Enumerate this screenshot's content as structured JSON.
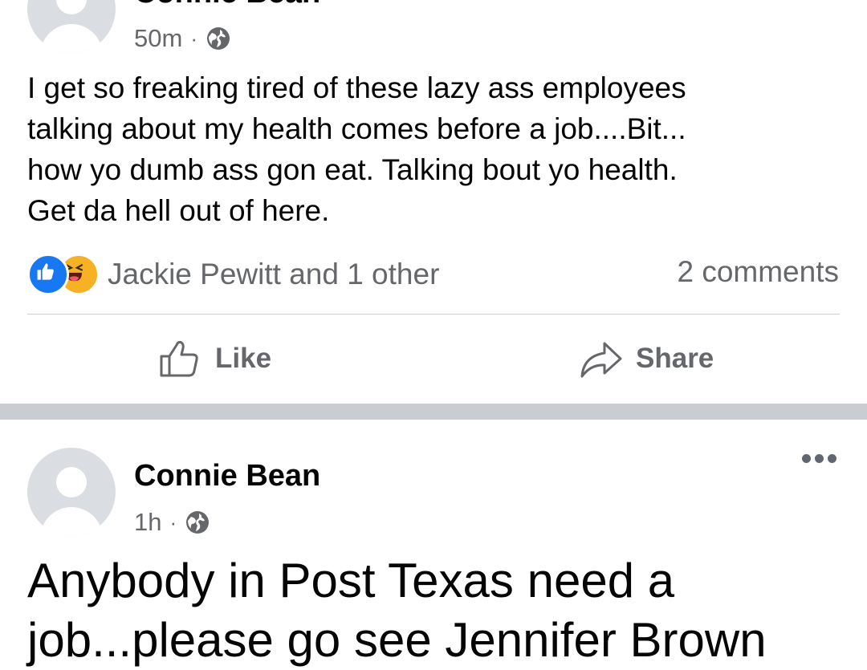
{
  "post1": {
    "author": "Connie Bean",
    "time": "50m",
    "visibility_icon": "globe-icon",
    "text_lines": [
      "I get so freaking tired of these lazy ass employees",
      "talking about my health comes before a job....Bit...",
      "how yo dumb ass gon eat.  Talking bout yo health.",
      "Get da hell out of here."
    ],
    "reactions": {
      "icons": [
        "like-reaction-icon",
        "haha-reaction-icon"
      ],
      "summary": "Jackie Pewitt and 1 other"
    },
    "comments": "2 comments",
    "actions": {
      "like": "Like",
      "share": "Share"
    }
  },
  "post2": {
    "author": "Connie Bean",
    "time": "1h",
    "visibility_icon": "globe-icon",
    "text_lines": [
      "Anybody in Post Texas need a",
      "job...please go see Jennifer Brown"
    ]
  },
  "colors": {
    "link_gray": "#65676b",
    "like_blue": "#1877f2",
    "haha_yellow": "#f7b125",
    "separator": "#c9ccd1"
  }
}
